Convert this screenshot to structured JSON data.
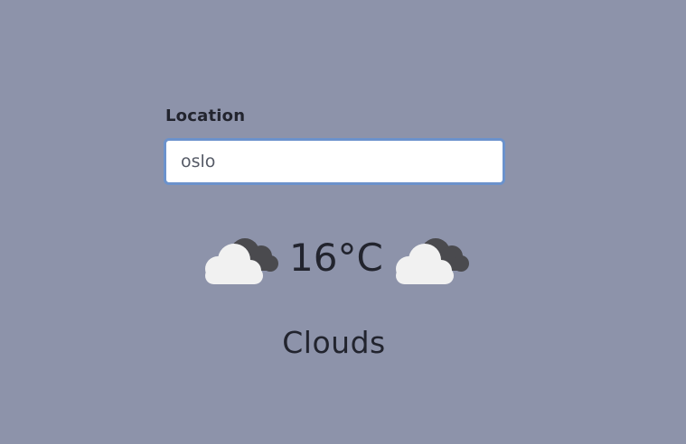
{
  "form": {
    "location_label": "Location",
    "location_value": "oslo"
  },
  "weather": {
    "temperature": "16°C",
    "condition": "Clouds",
    "icon": "cloud-icon"
  },
  "colors": {
    "background": "#8d93aa",
    "input_border": "#6b92cc",
    "text": "#22242e"
  }
}
